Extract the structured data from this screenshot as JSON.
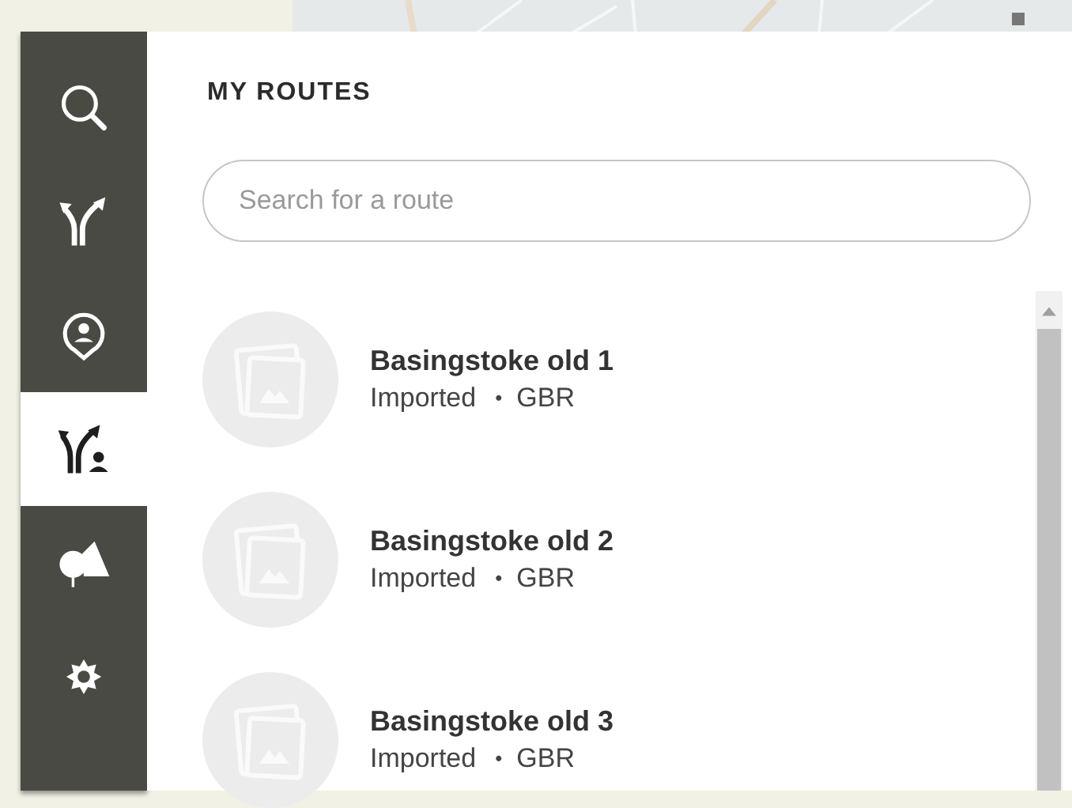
{
  "rail": {
    "tabs": [
      {
        "kind": "search",
        "selected": false
      },
      {
        "kind": "routes",
        "selected": false
      },
      {
        "kind": "places",
        "selected": false
      },
      {
        "kind": "my-routes",
        "selected": true
      },
      {
        "kind": "nature",
        "selected": false
      },
      {
        "kind": "settings",
        "selected": false
      }
    ]
  },
  "panel": {
    "title": "MY ROUTES",
    "search": {
      "placeholder": "Search for a route"
    },
    "routes": [
      {
        "name": "Basingstoke old 1",
        "source": "Imported",
        "separator": "•",
        "country": "GBR"
      },
      {
        "name": "Basingstoke old 2",
        "source": "Imported",
        "separator": "•",
        "country": "GBR"
      },
      {
        "name": "Basingstoke old 3",
        "source": "Imported",
        "separator": "•",
        "country": "GBR"
      }
    ]
  }
}
